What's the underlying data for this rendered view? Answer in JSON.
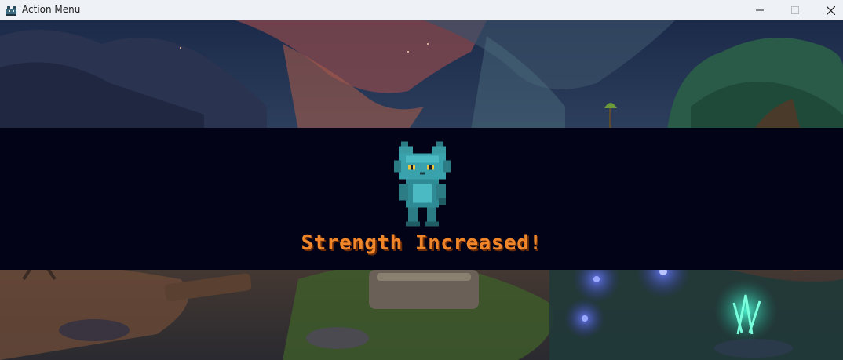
{
  "window": {
    "title": "Action Menu",
    "icon": "game-app-icon",
    "controls": [
      "minimize-icon",
      "maximize-icon",
      "close-icon"
    ]
  },
  "banner": {
    "message": "Strength Increased!",
    "message_color": "#f0862a",
    "background_color": "#020316",
    "character": "teal-cat-creature"
  },
  "scene": {
    "setting": "pixel-art forest clearing at dusk with glowing blue plants"
  }
}
